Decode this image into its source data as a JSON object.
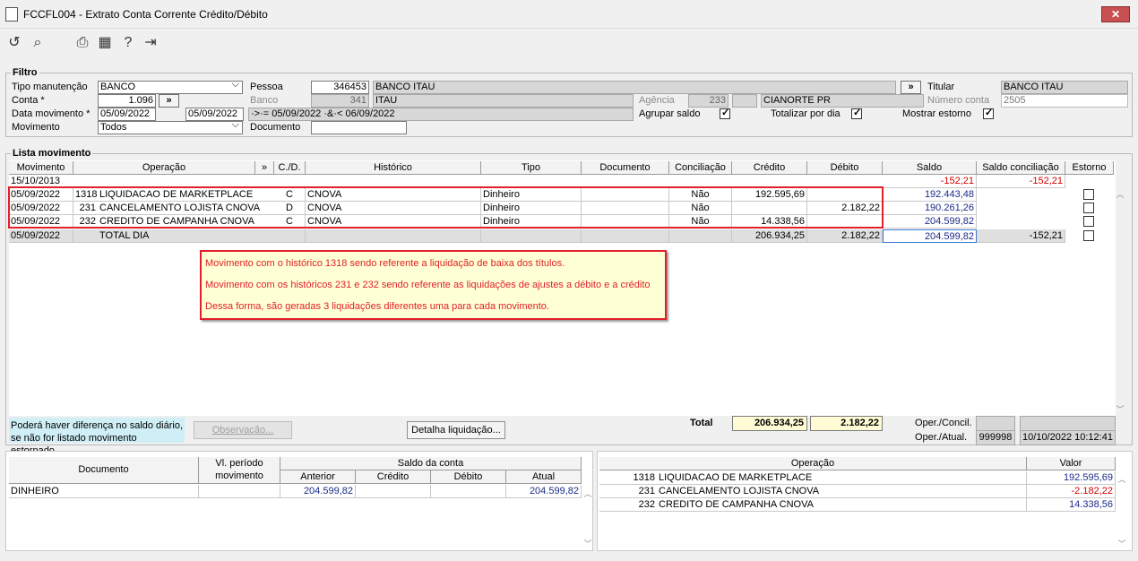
{
  "window": {
    "title": "FCCFL004 - Extrato Conta Corrente Crédito/Débito",
    "close_label": "✕"
  },
  "toolbar": {
    "icons": [
      "refresh-icon",
      "search-icon",
      "print-icon",
      "calendar-icon",
      "help-icon",
      "exit-icon"
    ]
  },
  "filtro": {
    "legend": "Filtro",
    "tipo_manutencao_label": "Tipo manutenção",
    "tipo_manutencao_value": "BANCO",
    "conta_label": "Conta *",
    "conta_value": "1.096",
    "conta_btn": "»",
    "data_movimento_label": "Data movimento *",
    "data_ini": "05/09/2022",
    "data_fim": "05/09/2022",
    "data_expr": "·>·= 05/09/2022 ·&·< 06/09/2022",
    "movimento_label": "Movimento",
    "movimento_value": "Todos",
    "pessoa_label": "Pessoa",
    "pessoa_code": "346453",
    "pessoa_name": "BANCO ITAU",
    "pessoa_btn": "»",
    "banco_label": "Banco",
    "banco_code": "341",
    "banco_name": "ITAU",
    "documento_label": "Documento",
    "documento_value": "",
    "agencia_label": "Agência",
    "agencia_code": "233",
    "agencia_name": "CIANORTE PR",
    "agrupar_saldo_label": "Agrupar saldo",
    "agrupar_saldo": true,
    "totalizar_dia_label": "Totalizar por dia",
    "totalizar_dia": true,
    "mostrar_estorno_label": "Mostrar estorno",
    "mostrar_estorno": true,
    "titular_label": "Titular",
    "titular_value": "BANCO ITAU",
    "numero_conta_label": "Número conta",
    "numero_conta_value": "2505"
  },
  "lista": {
    "legend": "Lista movimento",
    "headers": [
      "Movimento",
      "Operação",
      "»",
      "C./D.",
      "Histórico",
      "Tipo",
      "Documento",
      "Conciliação",
      "Crédito",
      "Débito",
      "Saldo",
      "Saldo conciliação",
      "Estorno"
    ],
    "opening": {
      "movimento": "15/10/2013",
      "saldo": "-152,21",
      "saldo_conc": "-152,21"
    },
    "rows": [
      {
        "movimento": "05/09/2022",
        "op_code": "1318",
        "operacao": "LIQUIDACAO DE MARKETPLACE",
        "cd": "C",
        "historico": "CNOVA",
        "tipo": "Dinheiro",
        "documento": "",
        "conciliacao": "Não",
        "credito": "192.595,69",
        "debito": "",
        "saldo": "192.443,48",
        "saldo_conc": ""
      },
      {
        "movimento": "05/09/2022",
        "op_code": "231",
        "operacao": "CANCELAMENTO LOJISTA CNOVA",
        "cd": "D",
        "historico": "CNOVA",
        "tipo": "Dinheiro",
        "documento": "",
        "conciliacao": "Não",
        "credito": "",
        "debito": "2.182,22",
        "saldo": "190.261,26",
        "saldo_conc": ""
      },
      {
        "movimento": "05/09/2022",
        "op_code": "232",
        "operacao": "CREDITO DE CAMPANHA CNOVA",
        "cd": "C",
        "historico": "CNOVA",
        "tipo": "Dinheiro",
        "documento": "",
        "conciliacao": "Não",
        "credito": "14.338,56",
        "debito": "",
        "saldo": "204.599,82",
        "saldo_conc": ""
      }
    ],
    "total": {
      "movimento": "05/09/2022",
      "operacao": "TOTAL DIA",
      "credito": "206.934,25",
      "debito": "2.182,22",
      "saldo": "204.599,82",
      "saldo_conc": "-152,21"
    }
  },
  "note": {
    "line1": "Movimento com o histórico 1318 sendo referente a liquidação de baixa dos títulos.",
    "line2": "Movimento com os históricos 231 e 232 sendo referente as liquidações de ajustes a débito e a crédito",
    "line3": "Dessa forma, são geradas 3 liquidações diferentes uma para cada movimento."
  },
  "footer": {
    "info_line1": "Poderá haver diferença no saldo diário,",
    "info_line2": "se não for listado movimento estornado.",
    "observacao_btn": "Observação...",
    "detalha_btn": "Detalha liquidação...",
    "total_label": "Total",
    "total_credito": "206.934,25",
    "total_debito": "2.182,22",
    "oper_concil_label": "Oper./Concil.",
    "oper_atual_label": "Oper./Atual.",
    "oper_atual_code": "999998",
    "oper_atual_date": "10/10/2022 10:12:41"
  },
  "doc_grid": {
    "headers": {
      "documento": "Documento",
      "vl_periodo": "Vl. período movimento",
      "saldo_conta": "Saldo da conta",
      "anterior": "Anterior",
      "credito": "Crédito",
      "debito": "Débito",
      "atual": "Atual"
    },
    "row": {
      "documento": "DINHEIRO",
      "vl_periodo": "",
      "anterior": "204.599,82",
      "credito": "",
      "debito": "",
      "atual": "204.599,82"
    }
  },
  "op_grid": {
    "headers": {
      "operacao": "Operação",
      "valor": "Valor"
    },
    "rows": [
      {
        "code": "1318",
        "name": "LIQUIDACAO DE MARKETPLACE",
        "valor": "192.595,69"
      },
      {
        "code": "231",
        "name": "CANCELAMENTO LOJISTA CNOVA",
        "valor": "-2.182,22"
      },
      {
        "code": "232",
        "name": "CREDITO DE CAMPANHA CNOVA",
        "valor": "14.338,56"
      }
    ]
  }
}
